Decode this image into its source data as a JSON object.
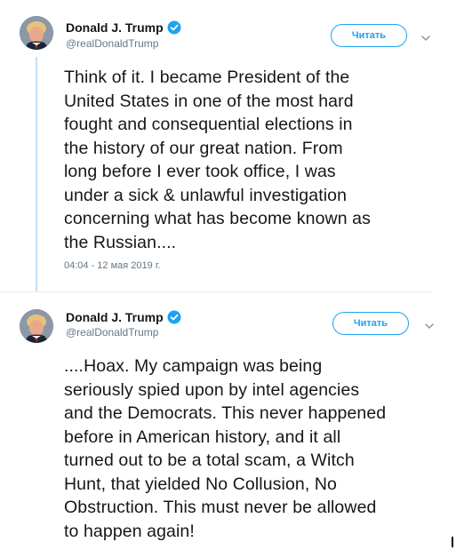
{
  "tweets": [
    {
      "display_name": "Donald J. Trump",
      "handle": "@realDonaldTrump",
      "follow_label": "Читать",
      "text": "Think of it. I became President of the\nUnited States in one of the most hard\nfought and consequential elections in\nthe history of our great nation. From\nlong before I ever took office, I was\nunder a sick & unlawful investigation\nconcerning what has become known as\nthe Russian....",
      "timestamp": "04:04 - 12 мая 2019 г."
    },
    {
      "display_name": "Donald J. Trump",
      "handle": "@realDonaldTrump",
      "follow_label": "Читать",
      "text": "....Hoax. My campaign was being\nseriously spied upon by intel agencies\nand the Democrats. This never happened\nbefore in American history, and it all\nturned out to be a total scam, a Witch\nHunt, that yielded No Collusion, No\nObstruction. This must never be allowed\nto happen again!"
    }
  ],
  "colors": {
    "accent": "#1da1f2",
    "thread_line": "#c4dff6",
    "secondary_text": "#657786",
    "primary_text": "#14171a"
  },
  "icons": {
    "verified": "verified-badge-icon",
    "more": "chevron-down-icon"
  }
}
